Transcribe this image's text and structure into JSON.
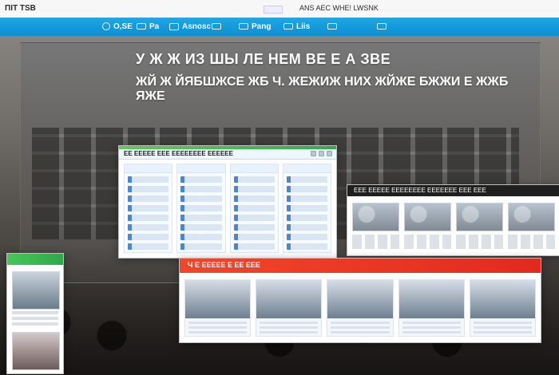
{
  "topbar": {
    "left_text": "ПIT TSB",
    "center_text": "ANS AEC WHE! LWSNK"
  },
  "nav": {
    "items": [
      {
        "label": "O,SE",
        "icon": "dot-icon"
      },
      {
        "label": "Pa",
        "icon": "paper-plane-icon"
      },
      {
        "label": "Asnosc",
        "icon": "mail-icon"
      },
      {
        "label": "",
        "icon": "grid-icon"
      },
      {
        "label": "Pang",
        "icon": "folder-icon"
      },
      {
        "label": "Liis",
        "icon": "check-icon"
      },
      {
        "label": "",
        "icon": "play-icon"
      },
      {
        "label": "",
        "icon": "window-icon"
      }
    ]
  },
  "hero": {
    "line1": "У Ж Ж ИЗ ШЫ ЛЕ НЕМ ВЕ Е А ЗВЕ",
    "line2": "ЖЙ Ж ЙЯБШЖСЕ ЖБ Ч. ЖЕЖИЖ НИХ ЖЙЖЕ БЖЖИ Е ЖЖБ ЯЖЕ"
  },
  "windows": {
    "a": {
      "title": "ЕЕ ЕЕЕЕЕ ЕЕЕ ЕЕЕЕЕЕЕЕ ЕЕЕЕЕЕ",
      "accent": "#3aa64d"
    },
    "b": {
      "title": "ЕЕЕ ЕЕЕЕЕ ЕЕЕЕЕЕЕЕ ЕЕЕЕЕЕЕ ЕЕЕ ЕЕЕ"
    },
    "c": {
      "title": ""
    },
    "d": {
      "title": "Ч Е ЕЕЕЕЕ Е ЕЕ ЕЕЕ"
    }
  }
}
